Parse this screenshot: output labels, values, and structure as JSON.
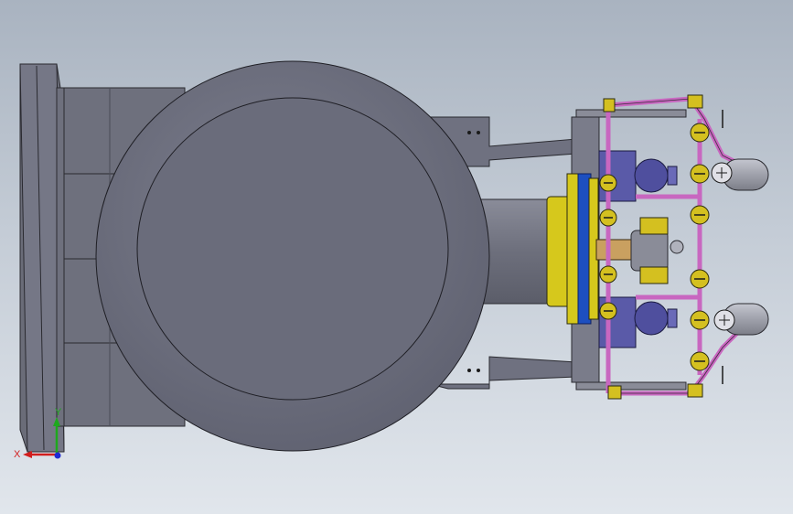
{
  "triad": {
    "x_label": "X",
    "y_label": "Y",
    "x_color": "#d21e1e",
    "y_color": "#1ea81e",
    "z_color": "#1e2ad2"
  },
  "colors": {
    "background_top": "#a9b3c0",
    "background_bottom": "#e1e6ec",
    "body_gray": "#7a7c8c",
    "flange_yellow": "#d6c81c",
    "flange_blue": "#1d4fc0",
    "pipe_magenta": "#c867c0",
    "motor_purple": "#5a5aa8",
    "valve_yellow": "#d4c020"
  }
}
